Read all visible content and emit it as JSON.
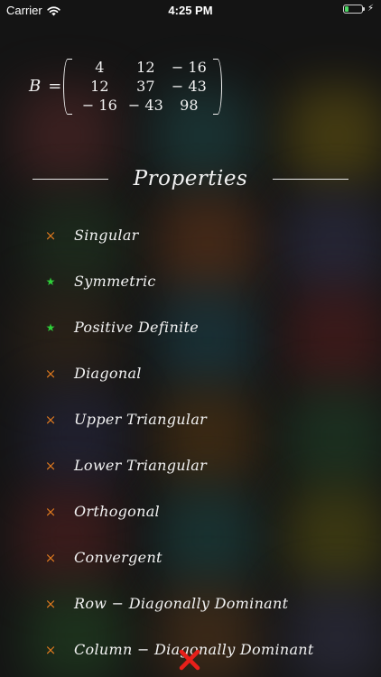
{
  "status_bar": {
    "carrier": "Carrier",
    "time": "4:25 PM",
    "battery_level": 0.2
  },
  "matrix": {
    "name": "B",
    "equals": "=",
    "rows": [
      [
        "4",
        "12",
        "− 16"
      ],
      [
        "12",
        "37",
        "− 43"
      ],
      [
        "− 16",
        "− 43",
        "98"
      ]
    ]
  },
  "properties": {
    "title": "Properties",
    "items": [
      {
        "label": "Singular",
        "holds": false
      },
      {
        "label": "Symmetric",
        "holds": true
      },
      {
        "label": "Positive Definite",
        "holds": true
      },
      {
        "label": "Diagonal",
        "holds": false
      },
      {
        "label": "Upper Triangular",
        "holds": false
      },
      {
        "label": "Lower Triangular",
        "holds": false
      },
      {
        "label": "Orthogonal",
        "holds": false
      },
      {
        "label": "Convergent",
        "holds": false
      },
      {
        "label": "Row − Diagonally Dominant",
        "holds": false
      },
      {
        "label": "Column − Diagonally Dominant",
        "holds": false
      }
    ]
  },
  "icons": {
    "false_marker": "cross-icon",
    "true_marker": "star-icon",
    "close": "close-icon"
  },
  "colors": {
    "background": "#141414",
    "cross": "#e07a1f",
    "star": "#2fd03a",
    "close": "#e8201a",
    "battery": "#4cd964"
  }
}
